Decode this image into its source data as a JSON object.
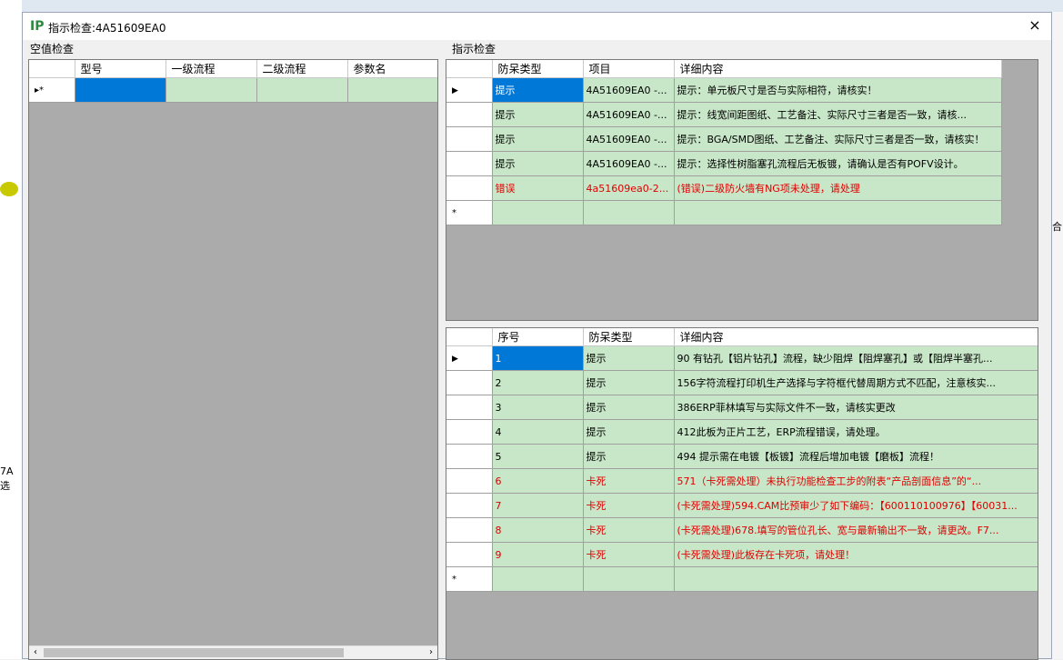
{
  "window": {
    "title": "指示检查:4A51609EA0",
    "close_symbol": "×"
  },
  "left_panel": {
    "label": "空值检查",
    "columns": [
      "型号",
      "一级流程",
      "二级流程",
      "参数名"
    ],
    "new_row_marker": "▸*"
  },
  "upper_right": {
    "label": "指示检查",
    "columns": [
      "防呆类型",
      "项目",
      "详细内容"
    ],
    "rows": [
      {
        "type": "提示",
        "item": "4A51609EA0 -...",
        "detail": "提示：单元板尺寸是否与实际相符，请核实！",
        "error": false
      },
      {
        "type": "提示",
        "item": "4A51609EA0 -...",
        "detail": "提示：线宽间距图纸、工艺备注、实际尺寸三者是否一致，请核...",
        "error": false
      },
      {
        "type": "提示",
        "item": "4A51609EA0 -...",
        "detail": "提示：BGA/SMD图纸、工艺备注、实际尺寸三者是否一致，请核实！",
        "error": false
      },
      {
        "type": "提示",
        "item": "4A51609EA0 -...",
        "detail": "提示：选择性树脂塞孔流程后无板镀，请确认是否有POFV设计。",
        "error": false
      },
      {
        "type": "错误",
        "item": "4a51609ea0-2...",
        "detail": "(错误)二级防火墙有NG项未处理，请处理",
        "error": true
      }
    ],
    "new_row_marker": "*"
  },
  "lower_right": {
    "columns": [
      "序号",
      "防呆类型",
      "详细内容"
    ],
    "rows": [
      {
        "no": "1",
        "type": "提示",
        "detail": "90 有钻孔【铝片钻孔】流程，缺少阻焊【阻焊塞孔】或【阻焊半塞孔...",
        "error": false
      },
      {
        "no": "2",
        "type": "提示",
        "detail": "156字符流程打印机生产选择与字符框代替周期方式不匹配，注意核实...",
        "error": false
      },
      {
        "no": "3",
        "type": "提示",
        "detail": "386ERP菲林填写与实际文件不一致，请核实更改",
        "error": false
      },
      {
        "no": "4",
        "type": "提示",
        "detail": "412此板为正片工艺，ERP流程错误，请处理。",
        "error": false
      },
      {
        "no": "5",
        "type": "提示",
        "detail": "494 提示需在电镀【板镀】流程后增加电镀【磨板】流程！",
        "error": false
      },
      {
        "no": "6",
        "type": "卡死",
        "detail": "571（卡死需处理）未执行功能检查工步的附表“产品剖面信息”的“...",
        "error": true
      },
      {
        "no": "7",
        "type": "卡死",
        "detail": "(卡死需处理)594.CAM比预审少了如下编码：【600110100976】【60031...",
        "error": true
      },
      {
        "no": "8",
        "type": "卡死",
        "detail": "(卡死需处理)678.填写的管位孔长、宽与最新输出不一致，请更改。F7...",
        "error": true
      },
      {
        "no": "9",
        "type": "卡死",
        "detail": "(卡死需处理)此板存在卡死项，请处理！",
        "error": true
      }
    ],
    "new_row_marker": "*"
  },
  "background_fragments": {
    "left_a": "7A",
    "left_b": "选",
    "right_a": "合"
  },
  "colors": {
    "row_bg": "#c8e6c8",
    "selected": "#0078d7",
    "error_text": "#e00000",
    "grid_bg": "#ababab"
  },
  "icons": {
    "row_pointer": "triangle-right-icon",
    "app": "app-logo-icon",
    "close": "close-icon"
  }
}
